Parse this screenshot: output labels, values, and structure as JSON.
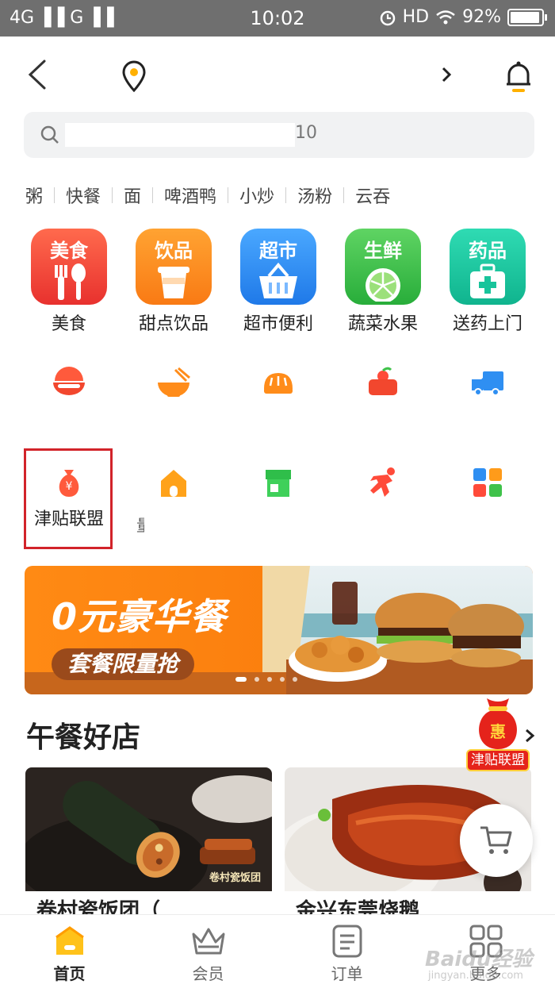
{
  "status_bar": {
    "network": "4G ▐▐ G ▐▐",
    "time": "10:02",
    "hd": "HD",
    "battery": "92%"
  },
  "header": {
    "location": ""
  },
  "search": {
    "placeholder_visible": "10"
  },
  "keywords": [
    "粥",
    "快餐",
    "面",
    "啤酒鸭",
    "小炒",
    "汤粉",
    "云吞"
  ],
  "categories": [
    {
      "tile_text": "美食",
      "label": "美食",
      "color": "#f0483e"
    },
    {
      "tile_text": "饮品",
      "label": "甜点饮品",
      "color": "#ff8a1f"
    },
    {
      "tile_text": "超市",
      "label": "超市便利",
      "color": "#2f8ff2"
    },
    {
      "tile_text": "生鲜",
      "label": "蔬菜水果",
      "color": "#3fc24a"
    },
    {
      "tile_text": "药品",
      "label": "送药上门",
      "color": "#1cc7a0"
    }
  ],
  "icon_row_1": [
    {
      "icon": "rice-bowl-icon"
    },
    {
      "icon": "noodle-bowl-icon"
    },
    {
      "icon": "bread-icon"
    },
    {
      "icon": "fruit-basket-icon"
    },
    {
      "icon": "delivery-truck-icon"
    }
  ],
  "icon_row_2": [
    {
      "icon": "money-bag-icon",
      "label": "津贴联盟"
    },
    {
      "icon": "house-icon",
      "label": ""
    },
    {
      "icon": "storefront-icon",
      "label": ""
    },
    {
      "icon": "runner-icon",
      "label": ""
    },
    {
      "icon": "grid-apps-icon",
      "label": ""
    }
  ],
  "cut_label": "量",
  "banner": {
    "title": "0元豪华餐",
    "subtitle": "套餐限量抢",
    "dots": 5
  },
  "section": {
    "title": "午餐好店"
  },
  "badge": {
    "top": "惠",
    "label": "津贴联盟"
  },
  "stores": [
    {
      "name": "卷村瓷饭团（",
      "photo_caption": "卷村瓷饭团"
    },
    {
      "name": "金兴东莞烧鹅",
      "photo_caption": ""
    }
  ],
  "bottom_nav": [
    {
      "label": "首页",
      "icon": "home-icon",
      "active": true
    },
    {
      "label": "会员",
      "icon": "crown-icon",
      "active": false
    },
    {
      "label": "订单",
      "icon": "order-list-icon",
      "active": false
    },
    {
      "label": "更多",
      "icon": "more-grid-icon",
      "active": false
    }
  ],
  "watermark": {
    "brand": "Baidu经验",
    "url": "jingyan.baidu.com"
  }
}
